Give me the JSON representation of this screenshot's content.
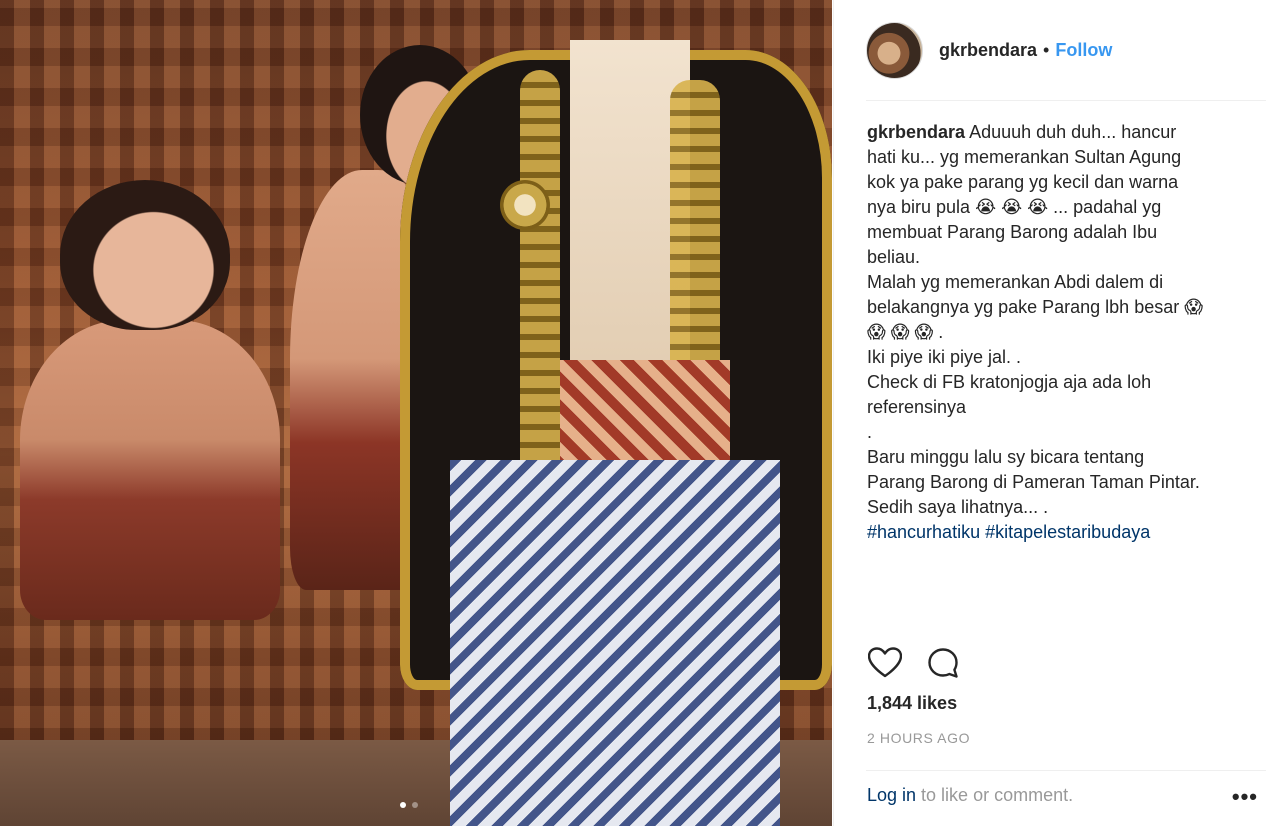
{
  "post": {
    "username": "gkrbendara",
    "separator": "•",
    "follow_label": "Follow",
    "caption_lines": [
      "Aduuuh duh duh... hancur",
      "hati ku... yg memerankan Sultan Agung",
      "kok ya pake parang yg kecil dan warna",
      "nya biru pula 😭 😭 😭 ... padahal yg",
      "membuat Parang Barong adalah Ibu",
      "beliau.",
      "Malah yg memerankan Abdi dalem di",
      "belakangnya yg pake Parang lbh besar 😱",
      "😱 😱 😱 .",
      "Iki piye iki piye jal. .",
      "Check di FB kratonjogja aja ada loh",
      "referensinya",
      ".",
      "Baru minggu lalu sy bicara tentang",
      "Parang Barong di Pameran Taman Pintar.",
      "Sedih saya lihatnya... ."
    ],
    "hashtags": [
      "#hancurhatiku",
      "#kitapelestaribudaya"
    ],
    "likes": "1,844 likes",
    "time": "2 HOURS AGO"
  },
  "footer": {
    "login_label": "Log in",
    "rest_label": " to like or comment.",
    "more_label": "•••"
  },
  "carousel": {
    "count": 2,
    "active_index": 0
  },
  "icons": {
    "like": "heart-icon",
    "comment": "comment-icon",
    "more": "more-options-icon"
  }
}
